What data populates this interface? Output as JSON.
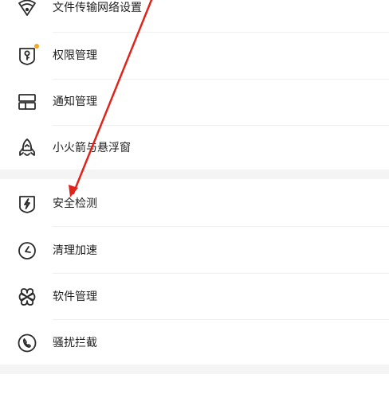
{
  "menu": {
    "section1": [
      {
        "label": "文件传输网络设置",
        "icon": "wifi-shield-icon"
      },
      {
        "label": "权限管理",
        "icon": "permission-key-icon",
        "badge": true
      },
      {
        "label": "通知管理",
        "icon": "notification-panel-icon"
      },
      {
        "label": "小火箭与悬浮窗",
        "icon": "rocket-icon"
      }
    ],
    "section2": [
      {
        "label": "安全检测",
        "icon": "security-bolt-shield-icon"
      },
      {
        "label": "清理加速",
        "icon": "speed-clock-icon"
      },
      {
        "label": "软件管理",
        "icon": "app-clover-icon"
      },
      {
        "label": "骚扰拦截",
        "icon": "phone-block-icon"
      }
    ]
  },
  "colors": {
    "text": "#222222",
    "badge": "#f5a623",
    "arrow": "#e0241b",
    "icon_stroke": "#2b2b2b"
  }
}
